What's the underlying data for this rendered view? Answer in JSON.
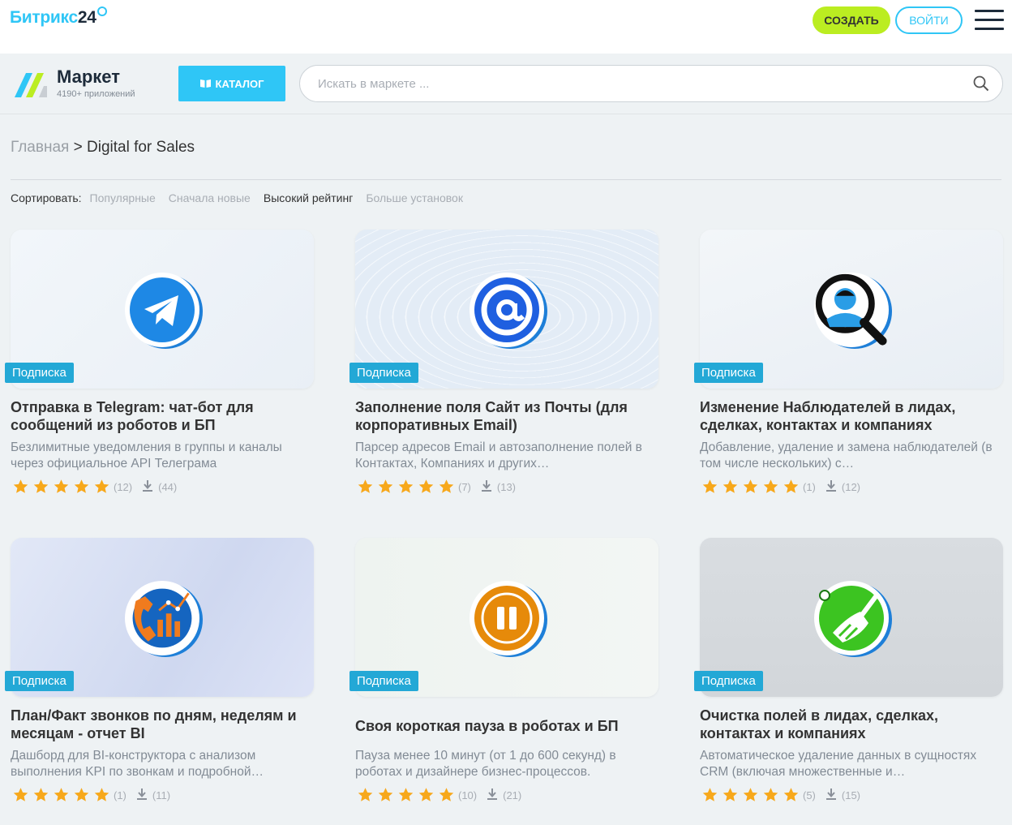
{
  "header": {
    "logo_main": "Битрикс",
    "logo_24": "24",
    "create_label": "СОЗДАТЬ",
    "login_label": "ВОЙТИ"
  },
  "market": {
    "title": "Маркет",
    "subtitle": "4190+ приложений",
    "catalog_label": "КАТАЛОГ",
    "search_placeholder": "Искать в маркете ..."
  },
  "breadcrumb": {
    "home": "Главная",
    "separator": ">",
    "current": "Digital for Sales"
  },
  "sort": {
    "label": "Сортировать:",
    "options": [
      "Популярные",
      "Сначала новые",
      "Высокий рейтинг",
      "Больше установок"
    ],
    "active_index": 2
  },
  "cards": [
    {
      "badge": "Подписка",
      "title": "Отправка в Telegram: чат-бот для сообщений из роботов и БП",
      "desc": "Безлимитные уведомления в группы и каналы через официальное API Телеграма",
      "rating_count": "(12)",
      "installs": "(44)",
      "icon": "telegram-icon"
    },
    {
      "badge": "Подписка",
      "title": "Заполнение поля Сайт из Почты (для корпоративных Email)",
      "desc": "Парсер адресов Email и автозаполнение полей в Контактах, Компаниях и других…",
      "rating_count": "(7)",
      "installs": "(13)",
      "icon": "at-sign-icon"
    },
    {
      "badge": "Подписка",
      "title": "Изменение Наблюдателей в лидах, сделках, контактах и компаниях",
      "desc": "Добавление, удаление и замена наблюдателей (в том числе нескольких) с…",
      "rating_count": "(1)",
      "installs": "(12)",
      "icon": "user-search-icon"
    },
    {
      "badge": "Подписка",
      "title": "План/Факт звонков по дням, неделям и месяцам - отчет BI",
      "desc": "Дашборд для BI-конструктора с анализом выполнения KPI по звонкам и подробной…",
      "rating_count": "(1)",
      "installs": "(11)",
      "icon": "phone-chart-icon"
    },
    {
      "badge": "Подписка",
      "title": "Своя короткая пауза в роботах и БП",
      "desc": "Пауза менее 10 минут (от 1 до 600 секунд) в роботах и дизайнере бизнес-процессов.",
      "rating_count": "(10)",
      "installs": "(21)",
      "icon": "pause-icon"
    },
    {
      "badge": "Подписка",
      "title": "Очистка полей в лидах, сделках, контактах и компаниях",
      "desc": "Автоматическое удаление данных в сущностях CRM (включая множественные и…",
      "rating_count": "(5)",
      "installs": "(15)",
      "icon": "broom-icon"
    }
  ],
  "colors": {
    "accent": "#2fc6f6",
    "create": "#bbed21",
    "badge": "#23a8d6",
    "star": "#f7a81b"
  }
}
